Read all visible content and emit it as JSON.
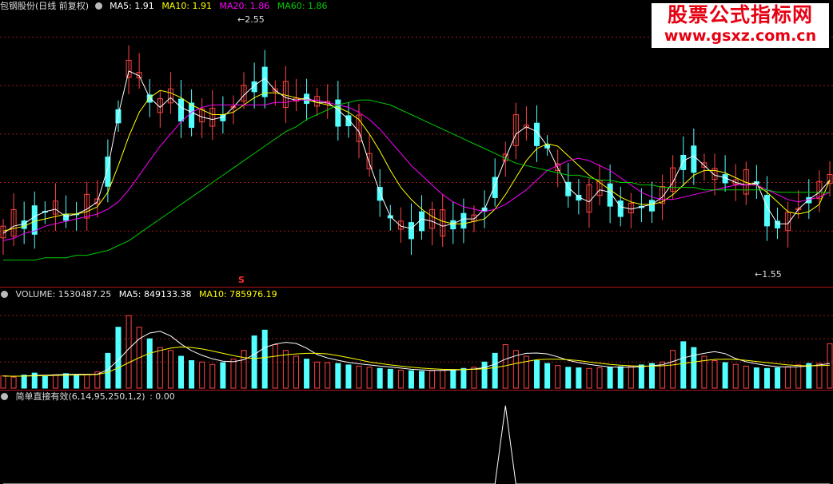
{
  "stock": {
    "name": "包钢股份",
    "period": "(日线 前复权)"
  },
  "main_legend": {
    "ma5": "MA5: 1.91",
    "ma10": "MA10: 1.91",
    "ma20": "MA20: 1.86",
    "ma60": "MA60: 1.86"
  },
  "high_marker": "2.55",
  "low_marker": "1.55",
  "signal_marker": "S",
  "volume_legend": {
    "volume": "VOLUME: 1530487.25",
    "ma5": "MA5: 849133.38",
    "ma10": "MA10: 785976.19"
  },
  "indicator_legend": {
    "name": "简单直接有效(6,14,95,250,1,2)",
    "value": ": 0.00"
  },
  "watermark": {
    "title": "股票公式指标网",
    "url": "www.gsxz.com.cn"
  },
  "colors": {
    "up": "#ff4444",
    "down": "#54ffff",
    "ma5": "#ffffff",
    "ma10": "#ffff00",
    "ma20": "#ff00ff",
    "ma60": "#00cc00",
    "grid": "#9a1b1b",
    "accent": "#e60012"
  },
  "chart_data": [
    {
      "type": "line",
      "title": "包钢股份 (日线 前复权)",
      "xlabel": "",
      "ylabel": "",
      "ylim": [
        1.5,
        2.6
      ],
      "x_points": 100,
      "grid": "on",
      "annotations": [
        "2.55",
        "1.55",
        "S"
      ],
      "series": [
        {
          "name": "MA5",
          "values": [
            1.69,
            1.72,
            1.73,
            1.76,
            1.78,
            1.79,
            1.76,
            1.77,
            1.79,
            1.82,
            1.96,
            2.18,
            2.36,
            2.34,
            2.25,
            2.21,
            2.25,
            2.21,
            2.19,
            2.17,
            2.16,
            2.17,
            2.21,
            2.26,
            2.3,
            2.33,
            2.28,
            2.25,
            2.24,
            2.25,
            2.23,
            2.23,
            2.2,
            2.16,
            2.11,
            1.98,
            1.86,
            1.76,
            1.72,
            1.71,
            1.75,
            1.74,
            1.72,
            1.73,
            1.75,
            1.75,
            1.79,
            1.89,
            2.0,
            2.1,
            2.13,
            2.11,
            2.05,
            1.96,
            1.88,
            1.84,
            1.82,
            1.87,
            1.86,
            1.8,
            1.79,
            1.8,
            1.81,
            1.84,
            1.9,
            1.99,
            2.01,
            1.97,
            1.93,
            1.92,
            1.9,
            1.89,
            1.9,
            1.8,
            1.73,
            1.73,
            1.79,
            1.83,
            1.86,
            1.91
          ]
        },
        {
          "name": "MA10",
          "values": [
            1.7,
            1.71,
            1.72,
            1.74,
            1.75,
            1.76,
            1.77,
            1.77,
            1.78,
            1.8,
            1.86,
            1.97,
            2.09,
            2.19,
            2.25,
            2.28,
            2.27,
            2.25,
            2.22,
            2.2,
            2.18,
            2.18,
            2.19,
            2.22,
            2.25,
            2.27,
            2.27,
            2.26,
            2.25,
            2.24,
            2.23,
            2.22,
            2.21,
            2.19,
            2.16,
            2.1,
            2.03,
            1.95,
            1.88,
            1.83,
            1.79,
            1.76,
            1.74,
            1.73,
            1.73,
            1.74,
            1.75,
            1.79,
            1.85,
            1.92,
            1.99,
            2.04,
            2.06,
            2.05,
            2.01,
            1.97,
            1.93,
            1.9,
            1.87,
            1.84,
            1.82,
            1.81,
            1.81,
            1.82,
            1.85,
            1.89,
            1.93,
            1.95,
            1.95,
            1.94,
            1.92,
            1.9,
            1.89,
            1.86,
            1.82,
            1.78,
            1.77,
            1.78,
            1.81,
            1.91
          ]
        },
        {
          "name": "MA20",
          "values": [
            1.66,
            1.67,
            1.69,
            1.7,
            1.72,
            1.73,
            1.74,
            1.75,
            1.76,
            1.77,
            1.79,
            1.82,
            1.87,
            1.93,
            1.99,
            2.05,
            2.1,
            2.15,
            2.19,
            2.21,
            2.22,
            2.22,
            2.22,
            2.22,
            2.22,
            2.22,
            2.23,
            2.23,
            2.24,
            2.24,
            2.24,
            2.23,
            2.22,
            2.21,
            2.19,
            2.16,
            2.12,
            2.07,
            2.02,
            1.97,
            1.93,
            1.89,
            1.85,
            1.82,
            1.8,
            1.79,
            1.78,
            1.79,
            1.81,
            1.84,
            1.87,
            1.91,
            1.95,
            1.97,
            1.99,
            2.0,
            1.99,
            1.97,
            1.95,
            1.92,
            1.89,
            1.86,
            1.84,
            1.83,
            1.83,
            1.84,
            1.85,
            1.86,
            1.87,
            1.88,
            1.89,
            1.89,
            1.89,
            1.87,
            1.85,
            1.83,
            1.82,
            1.83,
            1.84,
            1.86
          ]
        },
        {
          "name": "MA60",
          "values": [
            1.58,
            1.58,
            1.58,
            1.58,
            1.59,
            1.59,
            1.59,
            1.6,
            1.6,
            1.61,
            1.62,
            1.64,
            1.66,
            1.69,
            1.72,
            1.75,
            1.78,
            1.81,
            1.84,
            1.87,
            1.9,
            1.93,
            1.96,
            1.99,
            2.02,
            2.05,
            2.08,
            2.11,
            2.13,
            2.16,
            2.18,
            2.2,
            2.22,
            2.23,
            2.24,
            2.24,
            2.23,
            2.22,
            2.2,
            2.18,
            2.16,
            2.14,
            2.12,
            2.1,
            2.08,
            2.06,
            2.04,
            2.02,
            2.0,
            1.98,
            1.97,
            1.96,
            1.95,
            1.94,
            1.93,
            1.93,
            1.92,
            1.91,
            1.91,
            1.9,
            1.9,
            1.89,
            1.89,
            1.88,
            1.88,
            1.88,
            1.88,
            1.87,
            1.87,
            1.87,
            1.87,
            1.87,
            1.87,
            1.87,
            1.86,
            1.86,
            1.86,
            1.86,
            1.86,
            1.86
          ]
        }
      ]
    },
    {
      "type": "bar",
      "title": "VOLUME",
      "xlabel": "",
      "ylabel": "",
      "ylim": [
        0,
        3000000
      ],
      "grid": "on",
      "series": [
        {
          "name": "VOLUME",
          "values": [
            420000,
            380000,
            450000,
            520000,
            400000,
            460000,
            500000,
            430000,
            470000,
            560000,
            1200000,
            2100000,
            2500000,
            2100000,
            1700000,
            1400000,
            1300000,
            1100000,
            950000,
            900000,
            820000,
            880000,
            1000000,
            1300000,
            1800000,
            2000000,
            1500000,
            1300000,
            1100000,
            1000000,
            900000,
            880000,
            850000,
            800000,
            760000,
            720000,
            680000,
            650000,
            620000,
            600000,
            580000,
            600000,
            620000,
            640000,
            680000,
            720000,
            900000,
            1200000,
            1500000,
            1300000,
            1100000,
            950000,
            850000,
            780000,
            720000,
            700000,
            680000,
            700000,
            720000,
            740000,
            760000,
            800000,
            850000,
            900000,
            1300000,
            1600000,
            1400000,
            1100000,
            950000,
            880000,
            820000,
            760000,
            700000,
            680000,
            700000,
            740000,
            800000,
            850000,
            849133,
            1530487
          ]
        },
        {
          "name": "MA5",
          "values": [
            420000,
            410000,
            420000,
            440000,
            450000,
            460000,
            470000,
            480000,
            480000,
            480000,
            640000,
            970000,
            1360000,
            1700000,
            1900000,
            1960000,
            1800000,
            1520000,
            1290000,
            1130000,
            1010000,
            930000,
            910000,
            980000,
            1160000,
            1400000,
            1520000,
            1580000,
            1540000,
            1380000,
            1160000,
            1040000,
            960000,
            890000,
            840000,
            800000,
            760000,
            730000,
            690000,
            650000,
            630000,
            610000,
            610000,
            620000,
            640000,
            660000,
            710000,
            830000,
            1000000,
            1120000,
            1200000,
            1210000,
            1180000,
            1080000,
            960000,
            880000,
            820000,
            770000,
            730000,
            720000,
            720000,
            740000,
            770000,
            810000,
            920000,
            1040000,
            1130000,
            1200000,
            1260000,
            1190000,
            1020000,
            910000,
            840000,
            780000,
            740000,
            730000,
            740000,
            760000,
            800000,
            849133
          ]
        },
        {
          "name": "MA10",
          "values": [
            420000,
            410000,
            415000,
            425000,
            430000,
            440000,
            450000,
            455000,
            460000,
            470000,
            550000,
            700000,
            880000,
            1050000,
            1200000,
            1300000,
            1380000,
            1420000,
            1400000,
            1350000,
            1280000,
            1200000,
            1120000,
            1050000,
            1020000,
            1050000,
            1100000,
            1150000,
            1180000,
            1200000,
            1200000,
            1180000,
            1120000,
            1050000,
            980000,
            900000,
            850000,
            800000,
            760000,
            720000,
            690000,
            670000,
            650000,
            640000,
            640000,
            650000,
            670000,
            710000,
            770000,
            850000,
            920000,
            980000,
            1000000,
            1000000,
            980000,
            950000,
            900000,
            860000,
            820000,
            790000,
            770000,
            760000,
            760000,
            770000,
            800000,
            850000,
            900000,
            950000,
            990000,
            1000000,
            990000,
            960000,
            920000,
            880000,
            840000,
            800000,
            780000,
            770000,
            775000,
            785976
          ]
        }
      ]
    },
    {
      "type": "line",
      "title": "简单直接有效(6,14,95,250,1,2)",
      "xlabel": "",
      "ylabel": "",
      "ylim": [
        0,
        1
      ],
      "grid": "off",
      "series": [
        {
          "name": "简单直接有效",
          "values": [
            0,
            0,
            0,
            0,
            0,
            0,
            0,
            0,
            0,
            0,
            0,
            0,
            0,
            0,
            0,
            0,
            0,
            0,
            0,
            0,
            0,
            0,
            0,
            0,
            0,
            0,
            0,
            0,
            0,
            0,
            0,
            0,
            0,
            0,
            0,
            0,
            0,
            0,
            0,
            0,
            0,
            0,
            0,
            0,
            0,
            0,
            0,
            0,
            1,
            0,
            0,
            0,
            0,
            0,
            0,
            0,
            0,
            0,
            0,
            0,
            0,
            0,
            0,
            0,
            0,
            0,
            0,
            0,
            0,
            0,
            0,
            0,
            0,
            0,
            0,
            0,
            0,
            0,
            0,
            0
          ]
        }
      ]
    }
  ]
}
